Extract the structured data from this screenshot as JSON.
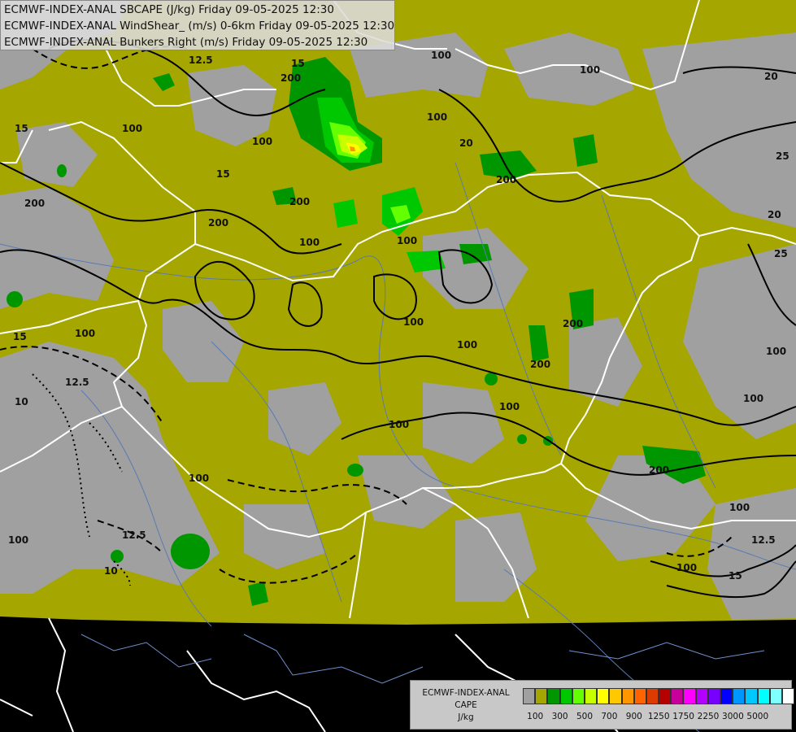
{
  "header": {
    "line1": "ECMWF-INDEX-ANAL SBCAPE (J/kg) Friday 09-05-2025 12:30",
    "line2": "ECMWF-INDEX-ANAL WindShear_ (m/s) 0-6km Friday 09-05-2025 12:30",
    "line3": "ECMWF-INDEX-ANAL Bunkers Right (m/s) Friday 09-05-2025 12:30"
  },
  "legend": {
    "line1": "ECMWF-INDEX-ANAL",
    "line2": "CAPE",
    "line3": "J/kg",
    "colors": [
      "#a0a0a0",
      "#a6a600",
      "#009600",
      "#00c800",
      "#64ff00",
      "#c8ff00",
      "#ffff00",
      "#ffc800",
      "#ff9600",
      "#ff6400",
      "#dc3c00",
      "#b40000",
      "#c8009b",
      "#ff00ff",
      "#b400ff",
      "#7800ff",
      "#0000ff",
      "#0096ff",
      "#00c8ff",
      "#00ffff",
      "#80ffff",
      "#ffffff"
    ],
    "ticks": [
      "100",
      "300",
      "500",
      "700",
      "900",
      "1250",
      "1750",
      "2250",
      "3000",
      "5000"
    ]
  },
  "colors": {
    "olive": "#a6a600",
    "gray": "#a0a0a0",
    "green": "#009600",
    "bright_green": "#00c800",
    "lime": "#64ff00",
    "yellow": "#ffff00",
    "orange": "#ff9600",
    "border": "#ffffff",
    "contour": "#000000",
    "river": "#5a7ab4",
    "background": "#000000"
  },
  "contour_labels": {
    "c1": "12.5",
    "c2": "15",
    "c3": "200",
    "c4": "100",
    "c5": "15",
    "c6": "100",
    "c7": "20",
    "c8": "15",
    "c9": "200",
    "c10": "100",
    "c11": "100",
    "c12": "200",
    "c13": "100",
    "c14": "100",
    "c15": "100",
    "c16": "20",
    "c17": "200",
    "c18": "15",
    "c19": "100",
    "c20": "10",
    "c21": "200",
    "c22": "100",
    "c23": "100",
    "c24": "100",
    "c25": "12.5",
    "c26": "100",
    "c27": "100",
    "c28": "200",
    "c29": "100",
    "c30": "200",
    "c31": "25",
    "c32": "20",
    "c33": "200",
    "c34": "100",
    "c35": "100",
    "c36": "12.5",
    "c37": "12.5",
    "c38": "15",
    "c39": "10",
    "c40": "25",
    "c41": "100",
    "c42": "100"
  }
}
